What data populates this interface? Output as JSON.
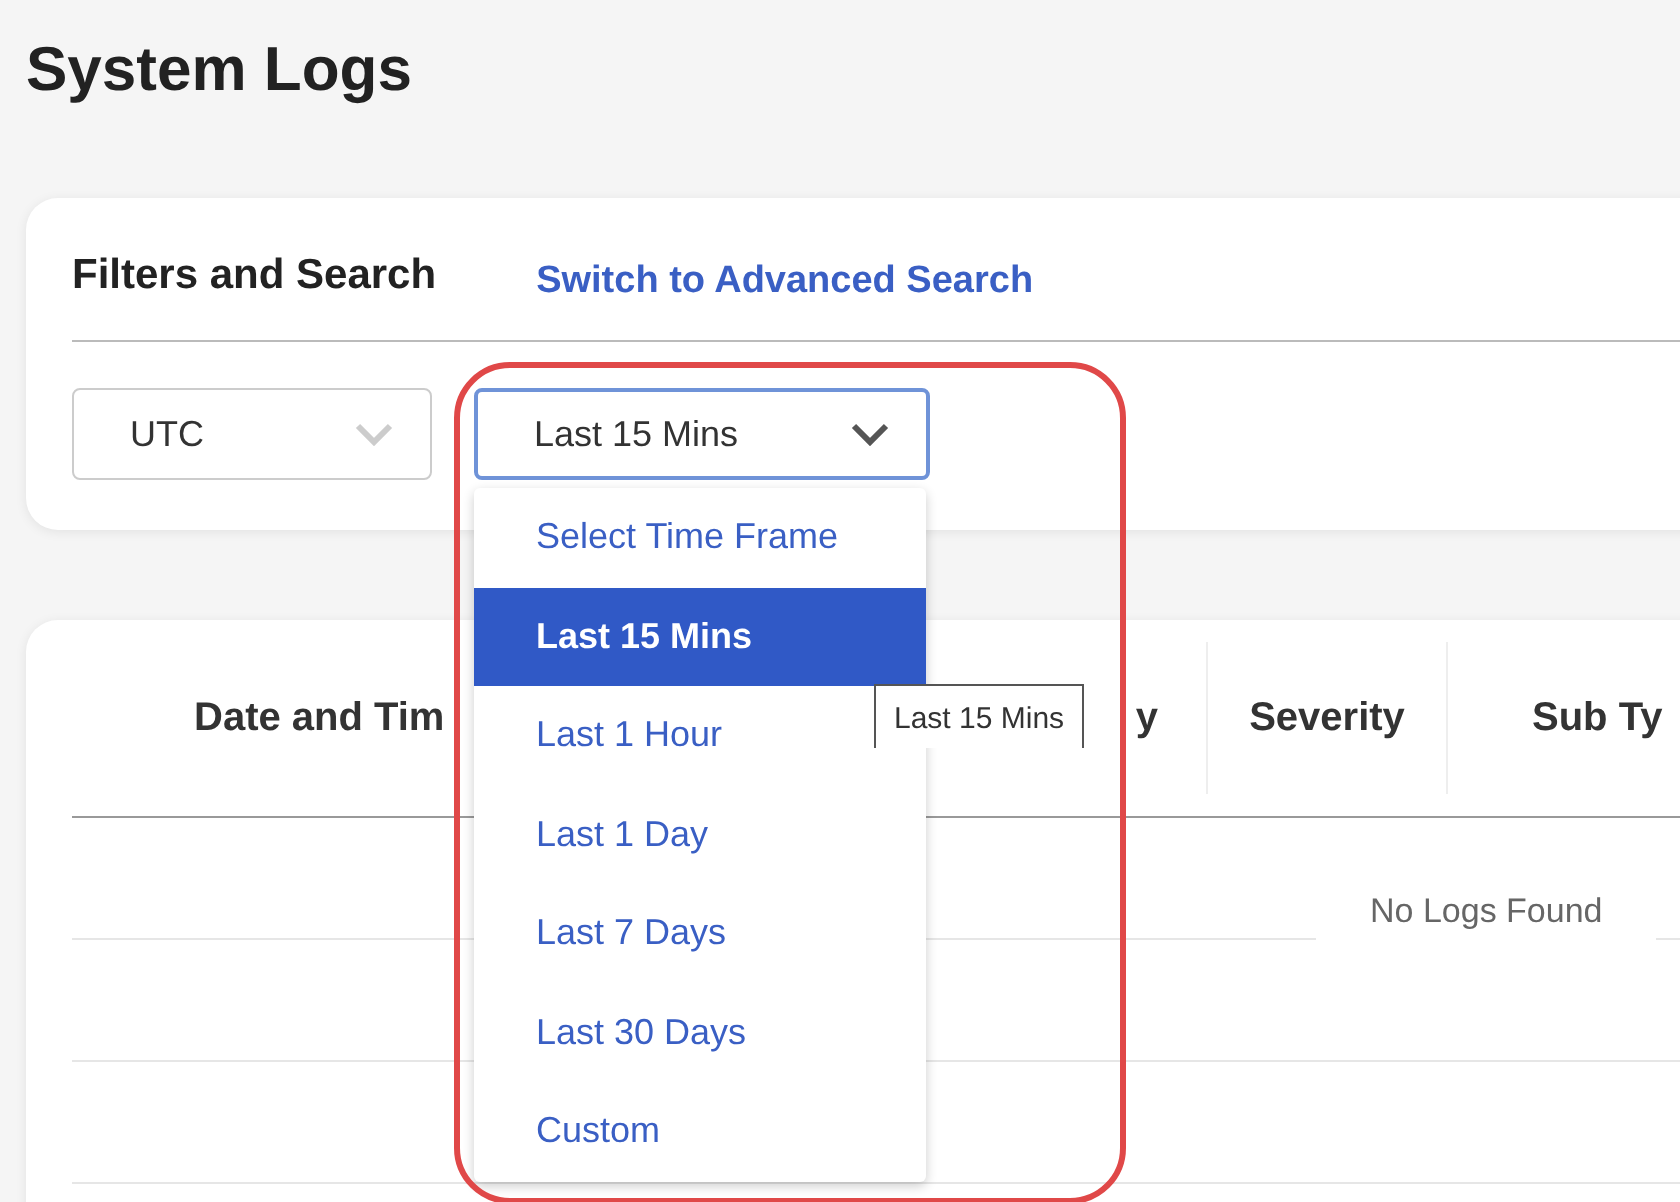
{
  "page_title": "System Logs",
  "filters": {
    "title": "Filters and Search",
    "advanced_link": "Switch to Advanced Search",
    "timezone": {
      "value": "UTC"
    },
    "time_frame": {
      "value": "Last 15 Mins",
      "open": true,
      "options": [
        {
          "label": "Select Time Frame",
          "selected": false
        },
        {
          "label": "Last 15 Mins",
          "selected": true
        },
        {
          "label": "Last 1 Hour",
          "selected": false
        },
        {
          "label": "Last 1 Day",
          "selected": false
        },
        {
          "label": "Last 7 Days",
          "selected": false
        },
        {
          "label": "Last 30 Days",
          "selected": false
        },
        {
          "label": "Custom",
          "selected": false
        }
      ]
    }
  },
  "tooltip": "Last 15 Mins",
  "table": {
    "columns": [
      "Date and Tim",
      "y",
      "Severity",
      "Sub Ty"
    ],
    "empty_message": "No Logs Found"
  },
  "highlight": true
}
